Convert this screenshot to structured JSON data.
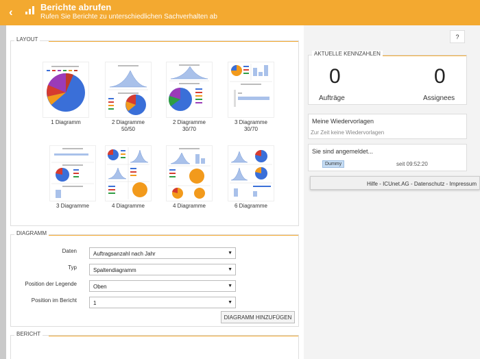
{
  "header": {
    "back_icon": "chevron-left-icon",
    "report_icon": "bar-chart-icon",
    "title": "Berichte abrufen",
    "subtitle": "Rufen Sie Berichte zu unterschiedlichen Sachverhalten ab"
  },
  "layout": {
    "section_title": "LAYOUT",
    "options": [
      {
        "label": "1 Diagramm"
      },
      {
        "label": "2 Diagramme\n50/50"
      },
      {
        "label": "2 Diagramme\n30/70"
      },
      {
        "label": "3 Diagramme\n30/70"
      },
      {
        "label": "3 Diagramme"
      },
      {
        "label": "4 Diagramme"
      },
      {
        "label": "4 Diagramme"
      },
      {
        "label": "6 Diagramme"
      }
    ]
  },
  "diagram": {
    "section_title": "DIAGRAMM",
    "fields": [
      {
        "label": "Daten",
        "value": "Auftragsanzahl nach Jahr"
      },
      {
        "label": "Typ",
        "value": "Spaltendiagramm"
      },
      {
        "label": "Position der Legende",
        "value": "Oben"
      },
      {
        "label": "Position im Bericht",
        "value": "1"
      }
    ],
    "add_button": "DIAGRAMM HINZUFÜGEN"
  },
  "report": {
    "section_title": "BERICHT"
  },
  "help_button": "?",
  "kpis": {
    "section_title": "AKTUELLE KENNZAHLEN",
    "items": [
      {
        "value": "0",
        "label": "Aufträge"
      },
      {
        "value": "0",
        "label": "Assignees"
      }
    ]
  },
  "templates": {
    "title": "Meine Wiedervorlagen",
    "empty_text": "Zur Zeit keine Wiedervorlagen"
  },
  "session": {
    "title": "Sie sind angemeldet...",
    "user": "Dummy",
    "since": "seit 09:52:20"
  },
  "footer": {
    "text": "Hilfe - ICUnet.AG - Datenschutz - Impressum"
  },
  "colors": {
    "accent": "#f3a930",
    "chart_blue": "#3a6fd8",
    "chart_orange": "#f29a1c",
    "badge_bg": "#c5dcf3"
  }
}
